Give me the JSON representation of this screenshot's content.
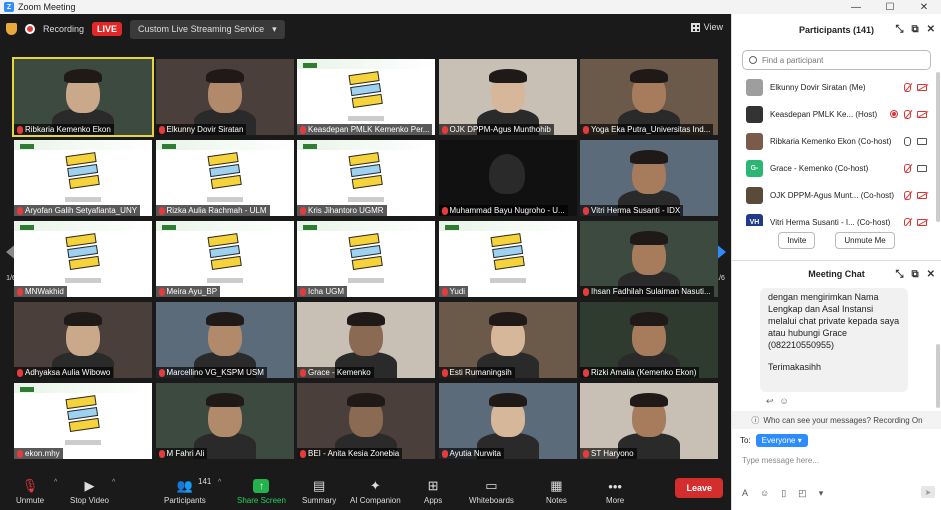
{
  "window": {
    "title": "Zoom Meeting",
    "app_icon": "Z"
  },
  "topbar": {
    "recording_label": "Recording",
    "live_badge": "LIVE",
    "stream_label": "Custom Live Streaming Service",
    "view_label": "View"
  },
  "pagination": {
    "left": "1/6",
    "right": "1/6"
  },
  "tiles": [
    {
      "name": "Ribkaria Kemenko Ekon",
      "kind": "cam",
      "active": true
    },
    {
      "name": "Elkunny Dovir Siratan",
      "kind": "cam"
    },
    {
      "name": "Keasdepan PMLK Kemenko Per...",
      "kind": "slide"
    },
    {
      "name": "OJK DPPM-Agus Munthohib",
      "kind": "cam"
    },
    {
      "name": "Yoga Eka Putra_Universitas Ind...",
      "kind": "cam"
    },
    {
      "name": "Aryofan Galih Setyafianta_UNY",
      "kind": "slide"
    },
    {
      "name": "Rizka Aulia Rachmah - ULM",
      "kind": "slide"
    },
    {
      "name": "Kris Jihantoro UGMR",
      "kind": "slide"
    },
    {
      "name": "Muhammad Bayu Nugroho - U...",
      "kind": "dark"
    },
    {
      "name": "Vitri Herma Susanti - IDX",
      "kind": "cam"
    },
    {
      "name": "MNWakhid",
      "kind": "slide"
    },
    {
      "name": "Meira Ayu_BP",
      "kind": "slide"
    },
    {
      "name": "Icha UGM",
      "kind": "slide"
    },
    {
      "name": "Yudi",
      "kind": "slide"
    },
    {
      "name": "Ihsan Fadhilah Sulaiman Nasuti...",
      "kind": "cam"
    },
    {
      "name": "Adhyaksa Aulia Wibowo",
      "kind": "cam"
    },
    {
      "name": "Marcellino VG_KSPM USM",
      "kind": "cam"
    },
    {
      "name": "Grace - Kemenko",
      "kind": "cam"
    },
    {
      "name": "Esti Rumaningsih",
      "kind": "cam"
    },
    {
      "name": "Rizki Amalia (Kemenko Ekon)",
      "kind": "cam"
    },
    {
      "name": "ekon.mhy",
      "kind": "slide"
    },
    {
      "name": "M Fahri Ali",
      "kind": "cam"
    },
    {
      "name": "BEI - Anita Kesia Zonebia",
      "kind": "cam"
    },
    {
      "name": "Ayutia Nurwita",
      "kind": "cam"
    },
    {
      "name": "ST Haryono",
      "kind": "cam"
    }
  ],
  "toolbar": {
    "unmute": "Unmute",
    "stop_video": "Stop Video",
    "participants": "Participants",
    "participants_count": "141",
    "share_screen": "Share Screen",
    "summary": "Summary",
    "ai_companion": "AI Companion",
    "apps": "Apps",
    "whiteboards": "Whiteboards",
    "notes": "Notes",
    "more": "More",
    "leave": "Leave"
  },
  "participants_panel": {
    "title": "Participants (141)",
    "search_placeholder": "Find a participant",
    "rows": [
      {
        "name": "Elkunny Dovir Siratan (Me)",
        "avatar_color": "#9e9e9e",
        "avatar_text": ""
      },
      {
        "name": "Keasdepan PMLK Ke... (Host)",
        "avatar_color": "#333333",
        "avatar_text": ""
      },
      {
        "name": "Ribkaria Kemenko Ekon (Co-host)",
        "avatar_color": "#7a5a4a",
        "avatar_text": ""
      },
      {
        "name": "Grace - Kemenko (Co-host)",
        "avatar_color": "#2bb673",
        "avatar_text": "G-"
      },
      {
        "name": "OJK DPPM-Agus Munt... (Co-host)",
        "avatar_color": "#5a4a3a",
        "avatar_text": ""
      },
      {
        "name": "Vitri Herma Susanti - I... (Co-host)",
        "avatar_color": "#1f3a8a",
        "avatar_text": "VH"
      }
    ],
    "invite": "Invite",
    "unmute_me": "Unmute Me"
  },
  "chat": {
    "title": "Meeting Chat",
    "message_lines": [
      "dengan mengirimkan Nama Lengkap dan Asal Instansi melalui chat private kepada saya atau hubungi Grace (082210550955)",
      "Terimakasihh"
    ],
    "visibility_note": "Who can see your messages? Recording On",
    "to_label": "To:",
    "to_value": "Everyone",
    "input_placeholder": "Type message here..."
  }
}
